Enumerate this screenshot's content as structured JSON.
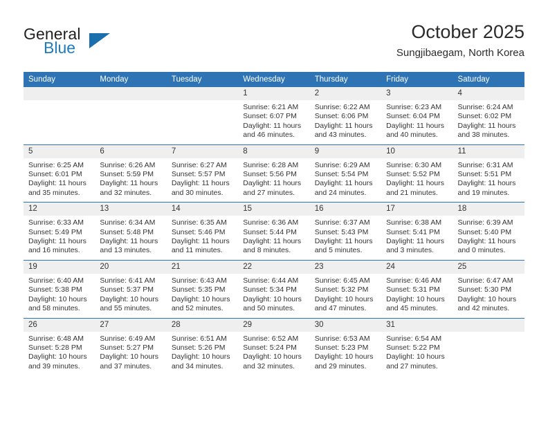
{
  "brand": {
    "name_part1": "General",
    "name_part2": "Blue",
    "logo_icon": "triangle-logo-icon"
  },
  "header": {
    "title": "October 2025",
    "subtitle": "Sungjibaegam, North Korea"
  },
  "colors": {
    "header_blue": "#2e74b5",
    "brand_blue": "#1e7bc0",
    "daynum_band": "#efefef",
    "text": "#333333"
  },
  "weekday_headers": [
    "Sunday",
    "Monday",
    "Tuesday",
    "Wednesday",
    "Thursday",
    "Friday",
    "Saturday"
  ],
  "weeks": [
    [
      {
        "day": "",
        "lines": []
      },
      {
        "day": "",
        "lines": []
      },
      {
        "day": "",
        "lines": []
      },
      {
        "day": "1",
        "lines": [
          "Sunrise: 6:21 AM",
          "Sunset: 6:07 PM",
          "Daylight: 11 hours",
          "and 46 minutes."
        ]
      },
      {
        "day": "2",
        "lines": [
          "Sunrise: 6:22 AM",
          "Sunset: 6:06 PM",
          "Daylight: 11 hours",
          "and 43 minutes."
        ]
      },
      {
        "day": "3",
        "lines": [
          "Sunrise: 6:23 AM",
          "Sunset: 6:04 PM",
          "Daylight: 11 hours",
          "and 40 minutes."
        ]
      },
      {
        "day": "4",
        "lines": [
          "Sunrise: 6:24 AM",
          "Sunset: 6:02 PM",
          "Daylight: 11 hours",
          "and 38 minutes."
        ]
      }
    ],
    [
      {
        "day": "5",
        "lines": [
          "Sunrise: 6:25 AM",
          "Sunset: 6:01 PM",
          "Daylight: 11 hours",
          "and 35 minutes."
        ]
      },
      {
        "day": "6",
        "lines": [
          "Sunrise: 6:26 AM",
          "Sunset: 5:59 PM",
          "Daylight: 11 hours",
          "and 32 minutes."
        ]
      },
      {
        "day": "7",
        "lines": [
          "Sunrise: 6:27 AM",
          "Sunset: 5:57 PM",
          "Daylight: 11 hours",
          "and 30 minutes."
        ]
      },
      {
        "day": "8",
        "lines": [
          "Sunrise: 6:28 AM",
          "Sunset: 5:56 PM",
          "Daylight: 11 hours",
          "and 27 minutes."
        ]
      },
      {
        "day": "9",
        "lines": [
          "Sunrise: 6:29 AM",
          "Sunset: 5:54 PM",
          "Daylight: 11 hours",
          "and 24 minutes."
        ]
      },
      {
        "day": "10",
        "lines": [
          "Sunrise: 6:30 AM",
          "Sunset: 5:52 PM",
          "Daylight: 11 hours",
          "and 21 minutes."
        ]
      },
      {
        "day": "11",
        "lines": [
          "Sunrise: 6:31 AM",
          "Sunset: 5:51 PM",
          "Daylight: 11 hours",
          "and 19 minutes."
        ]
      }
    ],
    [
      {
        "day": "12",
        "lines": [
          "Sunrise: 6:33 AM",
          "Sunset: 5:49 PM",
          "Daylight: 11 hours",
          "and 16 minutes."
        ]
      },
      {
        "day": "13",
        "lines": [
          "Sunrise: 6:34 AM",
          "Sunset: 5:48 PM",
          "Daylight: 11 hours",
          "and 13 minutes."
        ]
      },
      {
        "day": "14",
        "lines": [
          "Sunrise: 6:35 AM",
          "Sunset: 5:46 PM",
          "Daylight: 11 hours",
          "and 11 minutes."
        ]
      },
      {
        "day": "15",
        "lines": [
          "Sunrise: 6:36 AM",
          "Sunset: 5:44 PM",
          "Daylight: 11 hours",
          "and 8 minutes."
        ]
      },
      {
        "day": "16",
        "lines": [
          "Sunrise: 6:37 AM",
          "Sunset: 5:43 PM",
          "Daylight: 11 hours",
          "and 5 minutes."
        ]
      },
      {
        "day": "17",
        "lines": [
          "Sunrise: 6:38 AM",
          "Sunset: 5:41 PM",
          "Daylight: 11 hours",
          "and 3 minutes."
        ]
      },
      {
        "day": "18",
        "lines": [
          "Sunrise: 6:39 AM",
          "Sunset: 5:40 PM",
          "Daylight: 11 hours",
          "and 0 minutes."
        ]
      }
    ],
    [
      {
        "day": "19",
        "lines": [
          "Sunrise: 6:40 AM",
          "Sunset: 5:38 PM",
          "Daylight: 10 hours",
          "and 58 minutes."
        ]
      },
      {
        "day": "20",
        "lines": [
          "Sunrise: 6:41 AM",
          "Sunset: 5:37 PM",
          "Daylight: 10 hours",
          "and 55 minutes."
        ]
      },
      {
        "day": "21",
        "lines": [
          "Sunrise: 6:43 AM",
          "Sunset: 5:35 PM",
          "Daylight: 10 hours",
          "and 52 minutes."
        ]
      },
      {
        "day": "22",
        "lines": [
          "Sunrise: 6:44 AM",
          "Sunset: 5:34 PM",
          "Daylight: 10 hours",
          "and 50 minutes."
        ]
      },
      {
        "day": "23",
        "lines": [
          "Sunrise: 6:45 AM",
          "Sunset: 5:32 PM",
          "Daylight: 10 hours",
          "and 47 minutes."
        ]
      },
      {
        "day": "24",
        "lines": [
          "Sunrise: 6:46 AM",
          "Sunset: 5:31 PM",
          "Daylight: 10 hours",
          "and 45 minutes."
        ]
      },
      {
        "day": "25",
        "lines": [
          "Sunrise: 6:47 AM",
          "Sunset: 5:30 PM",
          "Daylight: 10 hours",
          "and 42 minutes."
        ]
      }
    ],
    [
      {
        "day": "26",
        "lines": [
          "Sunrise: 6:48 AM",
          "Sunset: 5:28 PM",
          "Daylight: 10 hours",
          "and 39 minutes."
        ]
      },
      {
        "day": "27",
        "lines": [
          "Sunrise: 6:49 AM",
          "Sunset: 5:27 PM",
          "Daylight: 10 hours",
          "and 37 minutes."
        ]
      },
      {
        "day": "28",
        "lines": [
          "Sunrise: 6:51 AM",
          "Sunset: 5:26 PM",
          "Daylight: 10 hours",
          "and 34 minutes."
        ]
      },
      {
        "day": "29",
        "lines": [
          "Sunrise: 6:52 AM",
          "Sunset: 5:24 PM",
          "Daylight: 10 hours",
          "and 32 minutes."
        ]
      },
      {
        "day": "30",
        "lines": [
          "Sunrise: 6:53 AM",
          "Sunset: 5:23 PM",
          "Daylight: 10 hours",
          "and 29 minutes."
        ]
      },
      {
        "day": "31",
        "lines": [
          "Sunrise: 6:54 AM",
          "Sunset: 5:22 PM",
          "Daylight: 10 hours",
          "and 27 minutes."
        ]
      },
      {
        "day": "",
        "lines": []
      }
    ]
  ]
}
